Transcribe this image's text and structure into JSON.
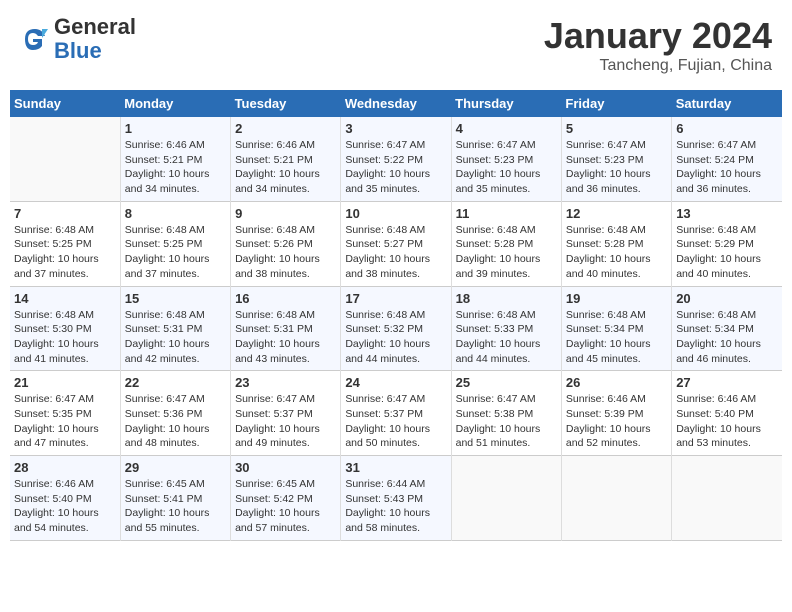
{
  "header": {
    "logo": {
      "line1": "General",
      "line2": "Blue"
    },
    "month": "January 2024",
    "location": "Tancheng, Fujian, China"
  },
  "weekdays": [
    "Sunday",
    "Monday",
    "Tuesday",
    "Wednesday",
    "Thursday",
    "Friday",
    "Saturday"
  ],
  "weeks": [
    [
      {
        "day": "",
        "info": ""
      },
      {
        "day": "1",
        "info": "Sunrise: 6:46 AM\nSunset: 5:21 PM\nDaylight: 10 hours\nand 34 minutes."
      },
      {
        "day": "2",
        "info": "Sunrise: 6:46 AM\nSunset: 5:21 PM\nDaylight: 10 hours\nand 34 minutes."
      },
      {
        "day": "3",
        "info": "Sunrise: 6:47 AM\nSunset: 5:22 PM\nDaylight: 10 hours\nand 35 minutes."
      },
      {
        "day": "4",
        "info": "Sunrise: 6:47 AM\nSunset: 5:23 PM\nDaylight: 10 hours\nand 35 minutes."
      },
      {
        "day": "5",
        "info": "Sunrise: 6:47 AM\nSunset: 5:23 PM\nDaylight: 10 hours\nand 36 minutes."
      },
      {
        "day": "6",
        "info": "Sunrise: 6:47 AM\nSunset: 5:24 PM\nDaylight: 10 hours\nand 36 minutes."
      }
    ],
    [
      {
        "day": "7",
        "info": "Sunrise: 6:48 AM\nSunset: 5:25 PM\nDaylight: 10 hours\nand 37 minutes."
      },
      {
        "day": "8",
        "info": "Sunrise: 6:48 AM\nSunset: 5:25 PM\nDaylight: 10 hours\nand 37 minutes."
      },
      {
        "day": "9",
        "info": "Sunrise: 6:48 AM\nSunset: 5:26 PM\nDaylight: 10 hours\nand 38 minutes."
      },
      {
        "day": "10",
        "info": "Sunrise: 6:48 AM\nSunset: 5:27 PM\nDaylight: 10 hours\nand 38 minutes."
      },
      {
        "day": "11",
        "info": "Sunrise: 6:48 AM\nSunset: 5:28 PM\nDaylight: 10 hours\nand 39 minutes."
      },
      {
        "day": "12",
        "info": "Sunrise: 6:48 AM\nSunset: 5:28 PM\nDaylight: 10 hours\nand 40 minutes."
      },
      {
        "day": "13",
        "info": "Sunrise: 6:48 AM\nSunset: 5:29 PM\nDaylight: 10 hours\nand 40 minutes."
      }
    ],
    [
      {
        "day": "14",
        "info": "Sunrise: 6:48 AM\nSunset: 5:30 PM\nDaylight: 10 hours\nand 41 minutes."
      },
      {
        "day": "15",
        "info": "Sunrise: 6:48 AM\nSunset: 5:31 PM\nDaylight: 10 hours\nand 42 minutes."
      },
      {
        "day": "16",
        "info": "Sunrise: 6:48 AM\nSunset: 5:31 PM\nDaylight: 10 hours\nand 43 minutes."
      },
      {
        "day": "17",
        "info": "Sunrise: 6:48 AM\nSunset: 5:32 PM\nDaylight: 10 hours\nand 44 minutes."
      },
      {
        "day": "18",
        "info": "Sunrise: 6:48 AM\nSunset: 5:33 PM\nDaylight: 10 hours\nand 44 minutes."
      },
      {
        "day": "19",
        "info": "Sunrise: 6:48 AM\nSunset: 5:34 PM\nDaylight: 10 hours\nand 45 minutes."
      },
      {
        "day": "20",
        "info": "Sunrise: 6:48 AM\nSunset: 5:34 PM\nDaylight: 10 hours\nand 46 minutes."
      }
    ],
    [
      {
        "day": "21",
        "info": "Sunrise: 6:47 AM\nSunset: 5:35 PM\nDaylight: 10 hours\nand 47 minutes."
      },
      {
        "day": "22",
        "info": "Sunrise: 6:47 AM\nSunset: 5:36 PM\nDaylight: 10 hours\nand 48 minutes."
      },
      {
        "day": "23",
        "info": "Sunrise: 6:47 AM\nSunset: 5:37 PM\nDaylight: 10 hours\nand 49 minutes."
      },
      {
        "day": "24",
        "info": "Sunrise: 6:47 AM\nSunset: 5:37 PM\nDaylight: 10 hours\nand 50 minutes."
      },
      {
        "day": "25",
        "info": "Sunrise: 6:47 AM\nSunset: 5:38 PM\nDaylight: 10 hours\nand 51 minutes."
      },
      {
        "day": "26",
        "info": "Sunrise: 6:46 AM\nSunset: 5:39 PM\nDaylight: 10 hours\nand 52 minutes."
      },
      {
        "day": "27",
        "info": "Sunrise: 6:46 AM\nSunset: 5:40 PM\nDaylight: 10 hours\nand 53 minutes."
      }
    ],
    [
      {
        "day": "28",
        "info": "Sunrise: 6:46 AM\nSunset: 5:40 PM\nDaylight: 10 hours\nand 54 minutes."
      },
      {
        "day": "29",
        "info": "Sunrise: 6:45 AM\nSunset: 5:41 PM\nDaylight: 10 hours\nand 55 minutes."
      },
      {
        "day": "30",
        "info": "Sunrise: 6:45 AM\nSunset: 5:42 PM\nDaylight: 10 hours\nand 57 minutes."
      },
      {
        "day": "31",
        "info": "Sunrise: 6:44 AM\nSunset: 5:43 PM\nDaylight: 10 hours\nand 58 minutes."
      },
      {
        "day": "",
        "info": ""
      },
      {
        "day": "",
        "info": ""
      },
      {
        "day": "",
        "info": ""
      }
    ]
  ]
}
